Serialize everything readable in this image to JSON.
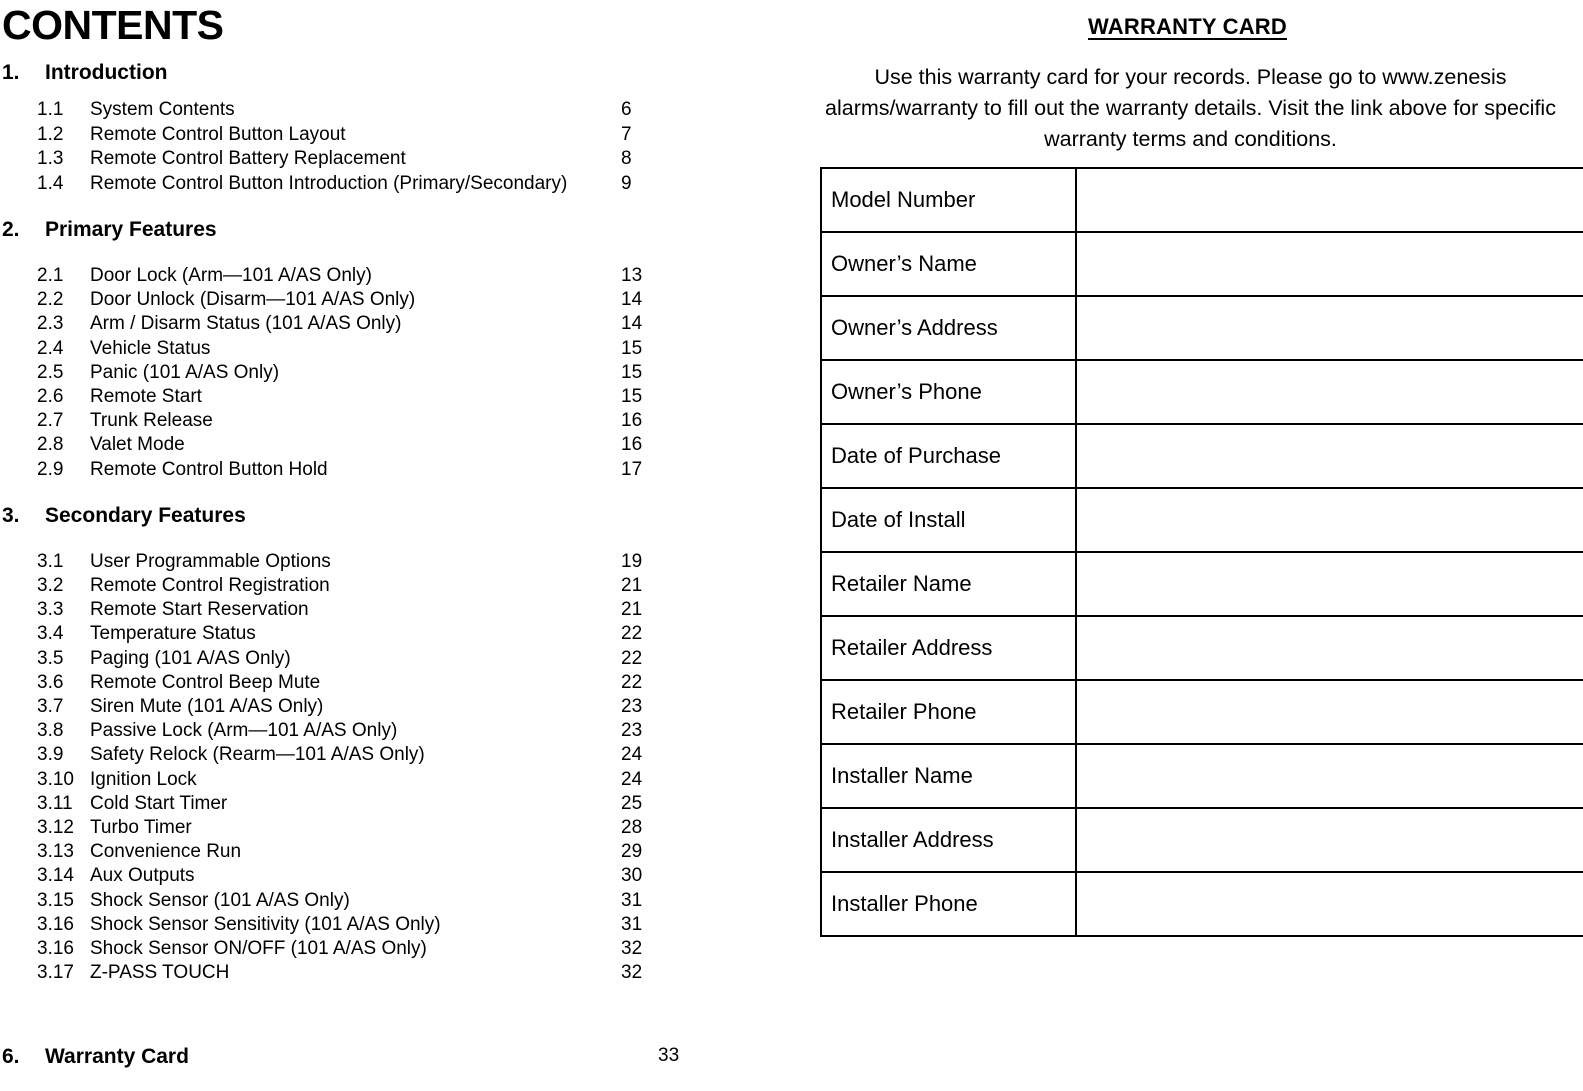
{
  "contents": {
    "title": "CONTENTS",
    "sections": [
      {
        "number": "1.",
        "label": "Introduction",
        "page": "",
        "items": [
          {
            "num": "1.1",
            "label": "System Contents",
            "page": "6"
          },
          {
            "num": "1.2",
            "label": "Remote Control Button Layout",
            "page": "7"
          },
          {
            "num": "1.3",
            "label": "Remote Control Battery Replacement",
            "page": "8"
          },
          {
            "num": "1.4",
            "label": "Remote Control Button Introduction (Primary/Secondary)",
            "page": "9"
          }
        ]
      },
      {
        "number": "2.",
        "label": "Primary Features",
        "page": "",
        "items": [
          {
            "num": "2.1",
            "label": "Door Lock (Arm—101 A/AS Only)",
            "page": "13"
          },
          {
            "num": "2.2",
            "label": "Door Unlock (Disarm—101 A/AS Only)",
            "page": "14"
          },
          {
            "num": "2.3",
            "label": "Arm / Disarm Status (101 A/AS Only)",
            "page": "14"
          },
          {
            "num": "2.4",
            "label": "Vehicle Status",
            "page": "15"
          },
          {
            "num": "2.5",
            "label": "Panic (101 A/AS Only)",
            "page": "15"
          },
          {
            "num": "2.6",
            "label": "Remote Start",
            "page": "15"
          },
          {
            "num": "2.7",
            "label": "Trunk Release",
            "page": "16"
          },
          {
            "num": "2.8",
            "label": "Valet Mode",
            "page": "16"
          },
          {
            "num": "2.9",
            "label": "Remote Control Button Hold",
            "page": "17"
          }
        ]
      },
      {
        "number": "3.",
        "label": "Secondary Features",
        "page": "",
        "items": [
          {
            "num": "3.1",
            "label": "User Programmable Options",
            "page": "19"
          },
          {
            "num": "3.2",
            "label": "Remote Control Registration",
            "page": "21"
          },
          {
            "num": "3.3",
            "label": "Remote Start Reservation",
            "page": "21"
          },
          {
            "num": "3.4",
            "label": "Temperature Status",
            "page": "22"
          },
          {
            "num": "3.5",
            "label": "Paging (101 A/AS Only)",
            "page": "22"
          },
          {
            "num": "3.6",
            "label": "Remote Control Beep Mute",
            "page": "22"
          },
          {
            "num": "3.7",
            "label": "Siren Mute (101 A/AS Only)",
            "page": "23"
          },
          {
            "num": "3.8",
            "label": "Passive Lock (Arm—101 A/AS Only)",
            "page": "23"
          },
          {
            "num": "3.9",
            "label": "Safety Relock (Rearm—101 A/AS Only)",
            "page": "24"
          },
          {
            "num": "3.10",
            "label": "Ignition Lock",
            "page": "24"
          },
          {
            "num": "3.11",
            "label": "Cold Start Timer",
            "page": "25"
          },
          {
            "num": "3.12",
            "label": "Turbo Timer",
            "page": "28"
          },
          {
            "num": "3.13",
            "label": "Convenience Run",
            "page": "29"
          },
          {
            "num": "3.14",
            "label": "Aux Outputs",
            "page": "30"
          },
          {
            "num": "3.15",
            "label": "Shock Sensor (101 A/AS Only)",
            "page": "31"
          },
          {
            "num": "3.16",
            "label": "Shock Sensor Sensitivity (101 A/AS Only)",
            "page": "31"
          },
          {
            "num": "3.16",
            "label": "Shock Sensor ON/OFF (101 A/AS Only)",
            "page": "32"
          },
          {
            "num": "3.17",
            "label": "Z-PASS TOUCH",
            "page": "32"
          }
        ]
      },
      {
        "number": "6.",
        "label": "Warranty Card",
        "page": "33",
        "items": []
      }
    ]
  },
  "warranty": {
    "title": "WARRANTY CARD",
    "blurb": "Use this warranty card for your records.  Please go to www.zenesis alarms/warranty to fill out the warranty details.  Visit the link above for specific warranty terms and conditions.",
    "fields": [
      {
        "label": "Model Number",
        "value": ""
      },
      {
        "label": "Owner’s Name",
        "value": ""
      },
      {
        "label": "Owner’s Address",
        "value": ""
      },
      {
        "label": "Owner’s Phone",
        "value": ""
      },
      {
        "label": "Date of Purchase",
        "value": ""
      },
      {
        "label": "Date of Install",
        "value": ""
      },
      {
        "label": "Retailer Name",
        "value": ""
      },
      {
        "label": "Retailer Address",
        "value": ""
      },
      {
        "label": "Retailer Phone",
        "value": ""
      },
      {
        "label": "Installer Name",
        "value": ""
      },
      {
        "label": "Installer Address",
        "value": ""
      },
      {
        "label": "Installer Phone",
        "value": ""
      }
    ]
  }
}
